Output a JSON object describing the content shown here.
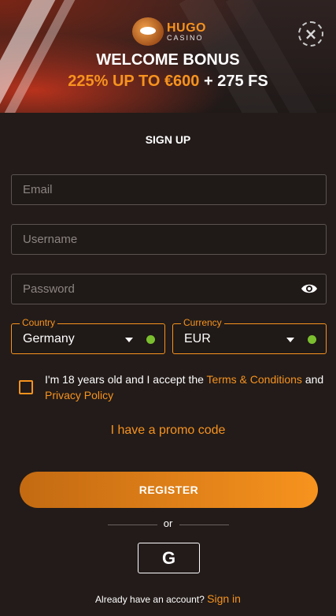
{
  "header": {
    "logo_big": "HUGO",
    "logo_small": "CASINO",
    "welcome": "WELCOME BONUS",
    "bonus_highlight": "225% UP TO €600",
    "bonus_rest": " + 275 FS",
    "close_icon": "close-icon"
  },
  "form": {
    "title": "SIGN UP",
    "email_placeholder": "Email",
    "username_placeholder": "Username",
    "password_placeholder": "Password",
    "country_label": "Country",
    "country_value": "Germany",
    "currency_label": "Currency",
    "currency_value": "EUR",
    "consent_prefix": "I'm 18 years old and I accept the ",
    "terms_link": "Terms & Conditions",
    "consent_middle": " and ",
    "privacy_link": "Privacy Policy",
    "promo": "I have a promo code",
    "register": "REGISTER",
    "or": "or",
    "google": "G",
    "account_text": "Already have an account? ",
    "sign_in": "Sign in"
  },
  "colors": {
    "accent": "#f7931e",
    "background": "#221b19",
    "valid": "#7bbf2f"
  }
}
